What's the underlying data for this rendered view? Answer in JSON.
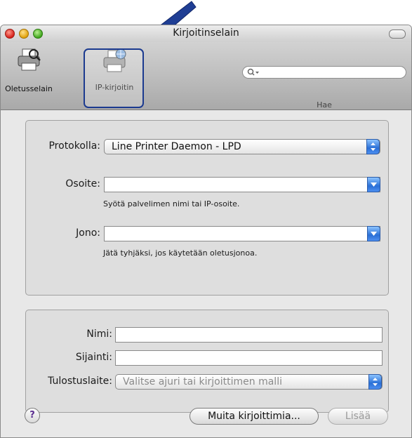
{
  "window": {
    "title": "Kirjoitinselain"
  },
  "toolbar": {
    "default_browser_label": "Oletusselain",
    "ip_printer_label": "IP-kirjoitin",
    "search_label": "Hae",
    "search_placeholder": ""
  },
  "connection": {
    "protocol_label": "Protokolla:",
    "protocol_value": "Line Printer Daemon - LPD",
    "address_label": "Osoite:",
    "address_value": "",
    "address_hint": "Syötä palvelimen nimi tai IP-osoite.",
    "queue_label": "Jono:",
    "queue_value": "",
    "queue_hint": "Jätä tyhjäksi, jos käytetään oletusjonoa."
  },
  "printer_info": {
    "name_label": "Nimi:",
    "name_value": "",
    "location_label": "Sijainti:",
    "location_value": "",
    "print_using_label": "Tulostuslaite:",
    "print_using_value": "Valitse ajuri tai kirjoittimen malli"
  },
  "footer": {
    "help_label": "?",
    "more_printers_label": "Muita kirjoittimia...",
    "add_label": "Lisää"
  },
  "colors": {
    "highlight_border": "#1b3a8f",
    "annotation_arrow": "#1f3e94",
    "accent_blue": "#2a6fd6"
  }
}
